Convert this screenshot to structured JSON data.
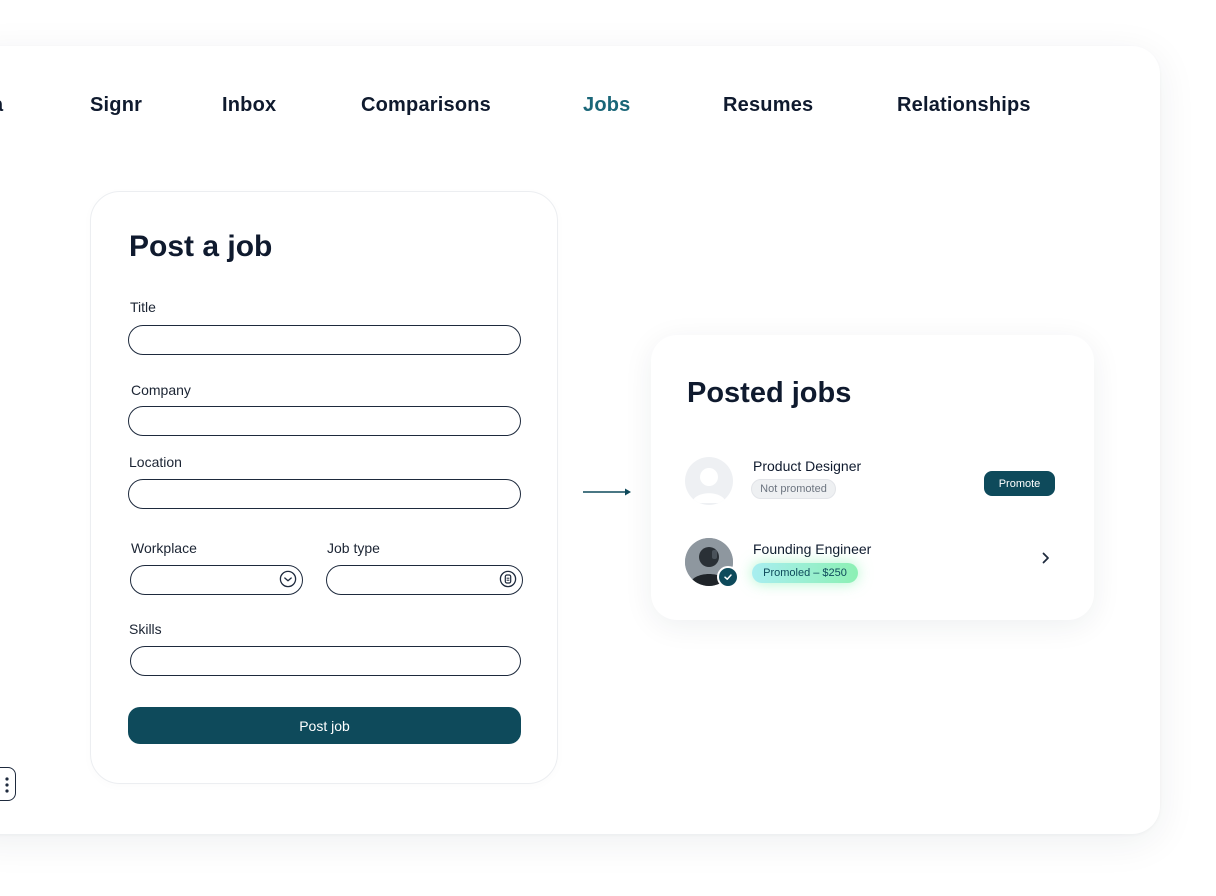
{
  "nav": {
    "partial_item": "a",
    "items": [
      {
        "label": "Signr"
      },
      {
        "label": "Inbox"
      },
      {
        "label": "Comparisons"
      },
      {
        "label": "Jobs"
      },
      {
        "label": "Resumes"
      },
      {
        "label": "Relationships"
      }
    ],
    "active": "Jobs"
  },
  "form": {
    "title": "Post a job",
    "fields": {
      "title": {
        "label": "Title",
        "value": ""
      },
      "company": {
        "label": "Company",
        "value": ""
      },
      "location": {
        "label": "Location",
        "value": ""
      },
      "workplace": {
        "label": "Workplace",
        "value": "",
        "icon": "chevron-down-circle-icon"
      },
      "job_type": {
        "label": "Job type",
        "value": "",
        "icon": "document-circle-icon"
      },
      "skills": {
        "label": "Skills",
        "value": ""
      }
    },
    "submit_label": "Post job"
  },
  "posted": {
    "title": "Posted jobs",
    "jobs": [
      {
        "title": "Product Designer",
        "status": "Not promoted",
        "action": "Promote",
        "avatar": "placeholder-avatar"
      },
      {
        "title": "Founding Engineer",
        "status": "Promoled – $250",
        "action": "chevron-right-icon",
        "avatar": "person-avatar",
        "verified": true
      }
    ]
  },
  "colors": {
    "accent": "#0e4a5b",
    "active_nav": "#1a6678",
    "text": "#0f1a2e",
    "promoted_gradient": [
      "#a8eef0",
      "#8cf0b4"
    ]
  }
}
